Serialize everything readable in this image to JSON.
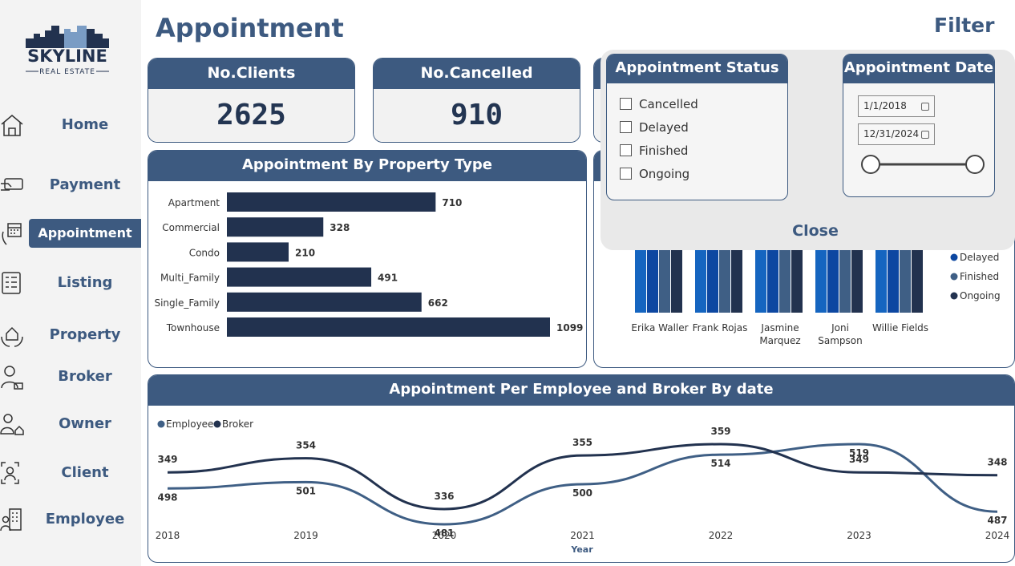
{
  "brand": {
    "name": "SKYLINE",
    "subtitle": "REAL ESTATE"
  },
  "page": {
    "title": "Appointment",
    "filter_label": "Filter"
  },
  "nav": [
    {
      "label": "Home"
    },
    {
      "label": "Payment"
    },
    {
      "label": "Appointment"
    },
    {
      "label": "Listing"
    },
    {
      "label": "Property"
    },
    {
      "label": "Broker"
    },
    {
      "label": "Owner"
    },
    {
      "label": "Client"
    },
    {
      "label": "Employee"
    }
  ],
  "kpis": [
    {
      "label": "No.Clients",
      "value": "2625"
    },
    {
      "label": "No.Cancelled",
      "value": "910"
    }
  ],
  "colors": {
    "primary": "#3d5a80",
    "dark": "#233552",
    "navy": "#22324f",
    "blue1": "#1565c0",
    "blue2": "#0d47a1",
    "slate": "#3f5f85",
    "panel_bg": "#f2f2f2"
  },
  "bar_chart": {
    "title": "Appointment By Property Type",
    "chart_data": {
      "type": "bar",
      "orientation": "horizontal",
      "categories": [
        "Apartment",
        "Commercial",
        "Condo",
        "Multi_Family",
        "Single_Family",
        "Townhouse"
      ],
      "values": [
        710,
        328,
        210,
        491,
        662,
        1099
      ],
      "xlim": [
        0,
        1099
      ]
    }
  },
  "employee_chart": {
    "chart_data": {
      "type": "bar",
      "categories": [
        "Erika Waller",
        "Frank Rojas",
        "Jasmine Marquez",
        "Joni Sampson",
        "Willie Fields"
      ],
      "series": [
        {
          "name": "Cancelled",
          "color": "#1565c0",
          "values": [
            90,
            88,
            88,
            88,
            88
          ]
        },
        {
          "name": "Delayed",
          "color": "#0d47a1",
          "values": [
            90,
            88,
            87,
            80,
            88
          ]
        },
        {
          "name": "Finished",
          "color": "#3f5f85",
          "values": [
            90,
            88,
            88,
            89,
            88
          ]
        },
        {
          "name": "Ongoing",
          "color": "#22324f",
          "values": [
            90,
            88,
            88,
            80,
            88
          ]
        }
      ],
      "legend_position": "right",
      "partially_hidden": true
    },
    "legend": [
      "Cancelled",
      "Delayed",
      "Finished",
      "Ongoing"
    ],
    "category_lines": [
      [
        "Erika Waller"
      ],
      [
        "Frank Rojas"
      ],
      [
        "Jasmine",
        "Marquez"
      ],
      [
        "Joni",
        "Sampson"
      ],
      [
        "Willie Fields"
      ]
    ]
  },
  "line_chart": {
    "title": "Appointment Per Employee and Broker By date",
    "chart_data": {
      "type": "line",
      "x": [
        "2018",
        "2019",
        "2020",
        "2021",
        "2022",
        "2023",
        "2024"
      ],
      "xlabel": "Year",
      "series": [
        {
          "name": "Employee",
          "color": "#3f5f85",
          "values": [
            498,
            501,
            481,
            500,
            514,
            519,
            487
          ]
        },
        {
          "name": "Broker",
          "color": "#22324f",
          "values": [
            349,
            354,
            336,
            355,
            359,
            349,
            348
          ]
        }
      ],
      "legend_position": "top-left"
    }
  },
  "filter_panel": {
    "status_title": "Appointment Status",
    "status_options": [
      "Cancelled",
      "Delayed",
      "Finished",
      "Ongoing"
    ],
    "date_title": "Appointment Date",
    "date_start": "1/1/2018",
    "date_end": "12/31/2024",
    "close_label": "Close"
  }
}
